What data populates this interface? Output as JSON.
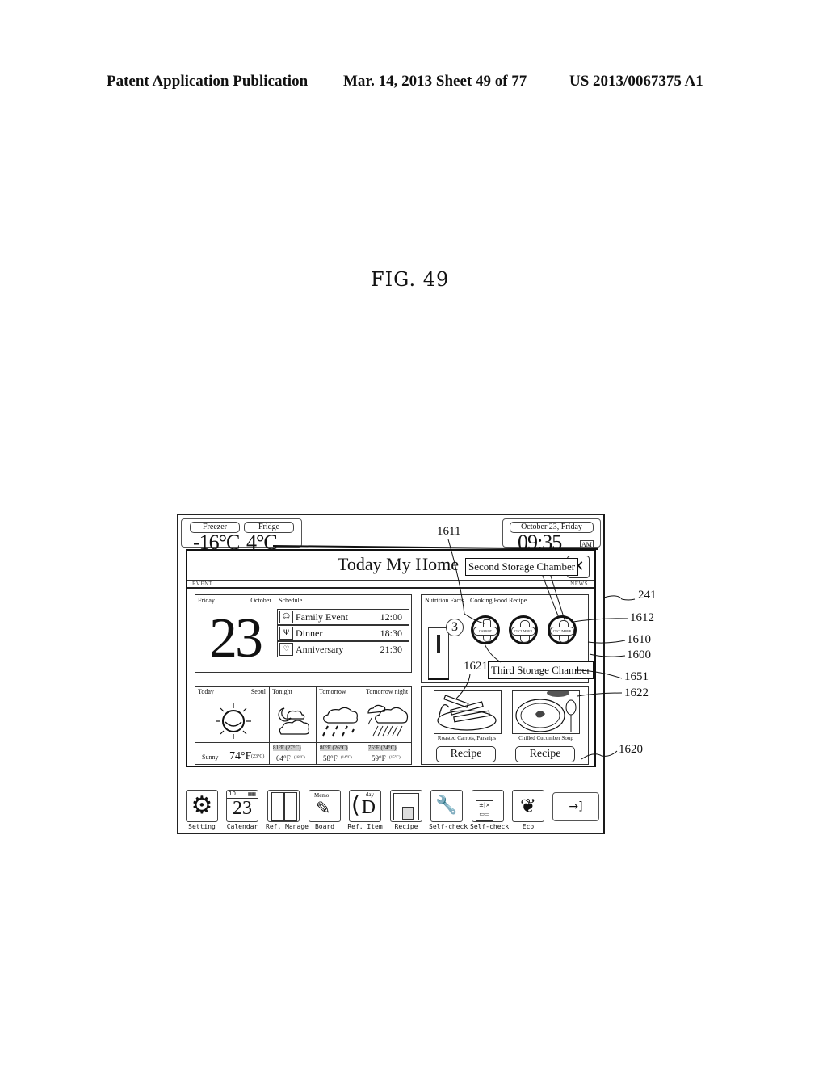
{
  "header": {
    "publication": "Patent Application Publication",
    "date_sheet": "Mar. 14, 2013  Sheet 49 of 77",
    "patent_number": "US 2013/0067375 A1"
  },
  "figure_label": "FIG. 49",
  "status_bar": {
    "freezer_label": "Freezer",
    "fridge_label": "Fridge",
    "freezer_temp": "-16°C",
    "fridge_temp": "4°C",
    "date": "October 23,  Friday",
    "time": "09:35",
    "ampm": "AM"
  },
  "popup": {
    "title": "Today My Home",
    "event_label": "EVENT",
    "news_label": "NEWS",
    "second_chamber_tag": "Second Storage Chamber",
    "third_chamber_tag": "Third Storage Chamber",
    "close_icon": "close-icon"
  },
  "calendar": {
    "day_name": "Friday",
    "month": "October",
    "day_number": "23"
  },
  "schedule": {
    "header": "Schedule",
    "items": [
      {
        "icon": "family-icon",
        "name": "Family Event",
        "time": "12:00"
      },
      {
        "icon": "dinner-icon",
        "name": "Dinner",
        "time": "18:30"
      },
      {
        "icon": "anniversary-icon",
        "name": "Anniversary",
        "time": "21:30"
      }
    ]
  },
  "weather": {
    "today": {
      "label": "Today",
      "city": "Seoul",
      "condition": "Sunny",
      "temp_f": "74°F",
      "temp_c": "(23°C)",
      "icon": "sun-icon"
    },
    "forecast": [
      {
        "label": "Tonight",
        "high": "81°F (27°C)",
        "low": "64°F",
        "low_c": "(18°C)",
        "icon": "night-cloud-icon"
      },
      {
        "label": "Tomorrow",
        "high": "80°F (26°C)",
        "low": "58°F",
        "low_c": "(14°C)",
        "icon": "rain-icon"
      },
      {
        "label": "Tomorrow night",
        "high": "75°F (24°C)",
        "low": "59°F",
        "low_c": "(15°C)",
        "icon": "heavy-rain-icon"
      }
    ]
  },
  "storage": {
    "tabs": [
      "Nutrition Facts",
      "Cooking Food Recipe"
    ],
    "chamber_number": "3",
    "chambers": [
      {
        "label": "CARROT"
      },
      {
        "label": "CUCUMBER"
      },
      {
        "label": "CUCUMBER"
      }
    ]
  },
  "recipes": [
    {
      "name": "Roasted Carrots, Parsnips",
      "button": "Recipe"
    },
    {
      "name": "Chilled Cucumber Soup",
      "button": "Recipe"
    }
  ],
  "dock": [
    {
      "label": "Setting",
      "icon": "gear-icon"
    },
    {
      "label": "Calendar",
      "icon": "calendar-icon",
      "top": "10",
      "number": "23"
    },
    {
      "label": "Ref. Manage",
      "icon": "refrigerator-icon"
    },
    {
      "label": "Board",
      "icon": "memo-pencil-icon",
      "glyph": "Memo"
    },
    {
      "label": "Ref. Item",
      "icon": "d-day-icon",
      "top": "day",
      "number": "D"
    },
    {
      "label": "Recipe",
      "icon": "recipe-book-icon"
    },
    {
      "label": "Self-check",
      "icon": "wrench-magnifier-icon"
    },
    {
      "label": "Self-check",
      "icon": "calculator-icon"
    },
    {
      "label": "Eco",
      "icon": "leaf-icon"
    },
    {
      "label": "",
      "icon": "exit-icon",
      "glyph": "→]"
    }
  ],
  "reference_numerals": {
    "r241": "241",
    "r1611": "1611",
    "r1612": "1612",
    "r1610": "1610",
    "r1600": "1600",
    "r1651": "1651",
    "r1621": "1621",
    "r1622": "1622",
    "r1620": "1620"
  }
}
